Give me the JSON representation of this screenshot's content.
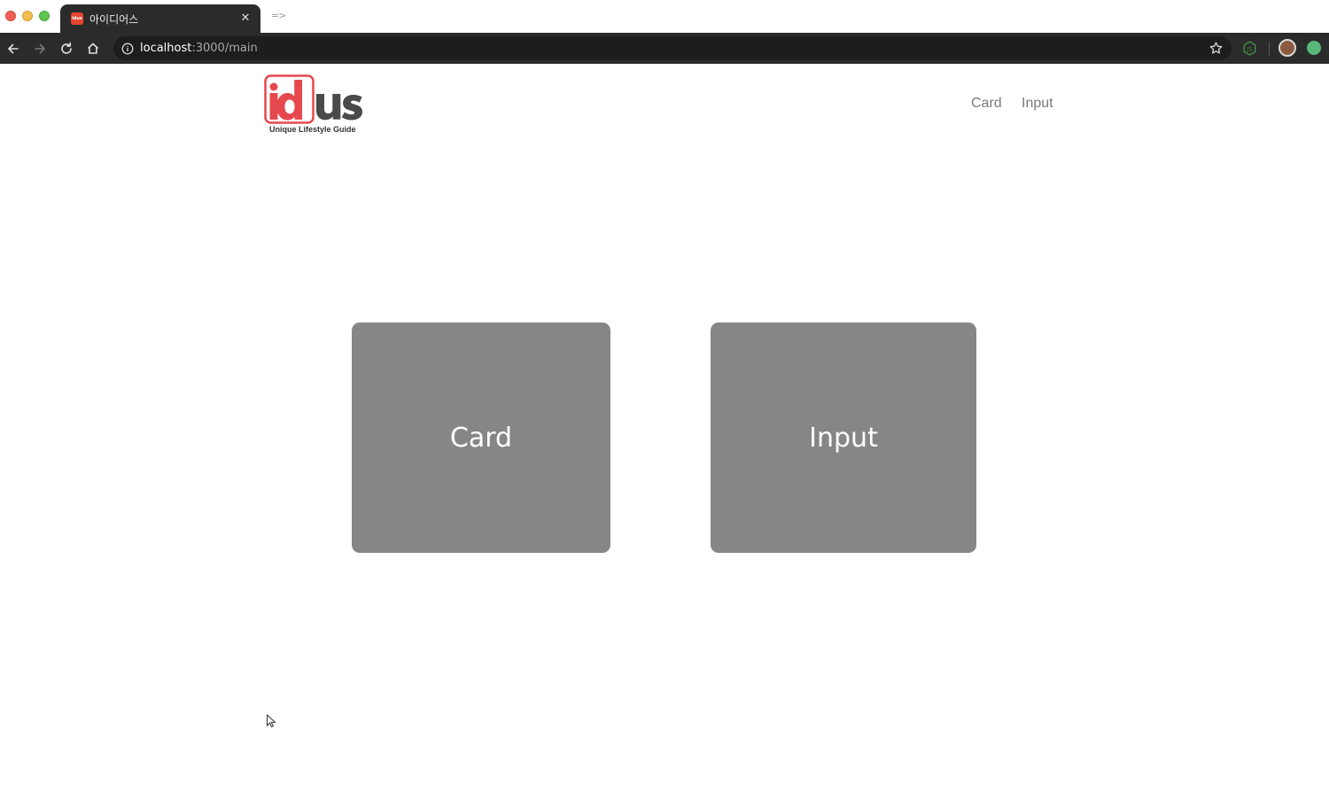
{
  "browser": {
    "tab": {
      "title": "아이디어스",
      "favicon_text": "idus",
      "close_glyph": "✕"
    },
    "new_tab_glyph": "=>",
    "url": {
      "host": "localhost",
      "path": ":3000/main"
    },
    "icons": {
      "back": "back-arrow-icon",
      "forward": "forward-arrow-icon",
      "reload": "reload-icon",
      "home": "home-icon",
      "info": "info-icon",
      "bookmark": "star-icon"
    }
  },
  "header": {
    "logo": {
      "brand_left": "id",
      "brand_right": "us",
      "tagline": "Unique Lifestyle Guide",
      "brand_color": "#e5484d",
      "dark_color": "#4a4a4a"
    },
    "nav": {
      "card_label": "Card",
      "input_label": "Input"
    }
  },
  "main": {
    "tiles": [
      {
        "label": "Card"
      },
      {
        "label": "Input"
      }
    ],
    "tile_color": "#868686"
  }
}
